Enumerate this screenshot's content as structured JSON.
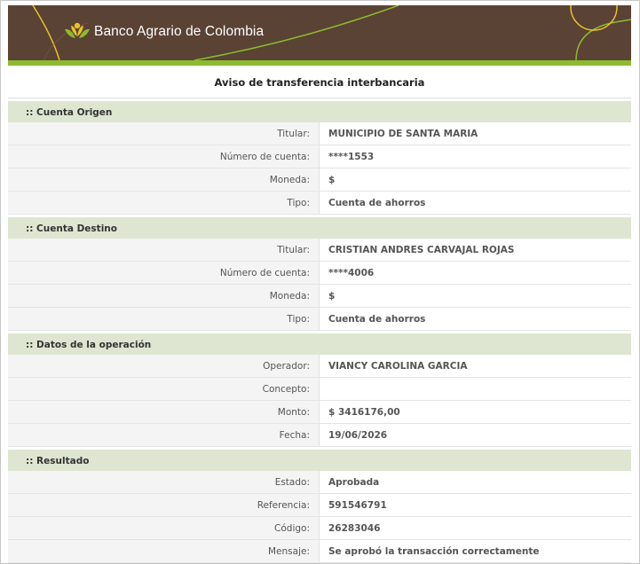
{
  "brand": {
    "name": "Banco Agrario de Colombia"
  },
  "page": {
    "title": "Aviso de transferencia interbancaria"
  },
  "colors": {
    "banner": "#5a4234",
    "accent_green": "#8cbb2f",
    "section_bg": "#dee6d1",
    "deco_yellow": "#e8c22a"
  },
  "sections": [
    {
      "heading": ":: Cuenta Origen",
      "rows": [
        {
          "label": "Titular:",
          "value": "MUNICIPIO DE SANTA MARIA"
        },
        {
          "label": "Número de cuenta:",
          "value": "****1553"
        },
        {
          "label": "Moneda:",
          "value": "$"
        },
        {
          "label": "Tipo:",
          "value": "Cuenta de ahorros"
        }
      ]
    },
    {
      "heading": ":: Cuenta Destino",
      "rows": [
        {
          "label": "Titular:",
          "value": "CRISTIAN ANDRES CARVAJAL ROJAS"
        },
        {
          "label": "Número de cuenta:",
          "value": "****4006"
        },
        {
          "label": "Moneda:",
          "value": "$"
        },
        {
          "label": "Tipo:",
          "value": "Cuenta de ahorros"
        }
      ]
    },
    {
      "heading": ":: Datos de la operación",
      "rows": [
        {
          "label": "Operador:",
          "value": "VIANCY CAROLINA GARCIA"
        },
        {
          "label": "Concepto:",
          "value": ""
        },
        {
          "label": "Monto:",
          "value": "$ 3416176,00"
        },
        {
          "label": "Fecha:",
          "value": "19/06/2026"
        }
      ]
    },
    {
      "heading": ":: Resultado",
      "rows": [
        {
          "label": "Estado:",
          "value": "Aprobada"
        },
        {
          "label": "Referencia:",
          "value": "591546791"
        },
        {
          "label": "Código:",
          "value": "26283046"
        },
        {
          "label": "Mensaje:",
          "value": "Se aprobó la transacción correctamente"
        }
      ]
    }
  ]
}
